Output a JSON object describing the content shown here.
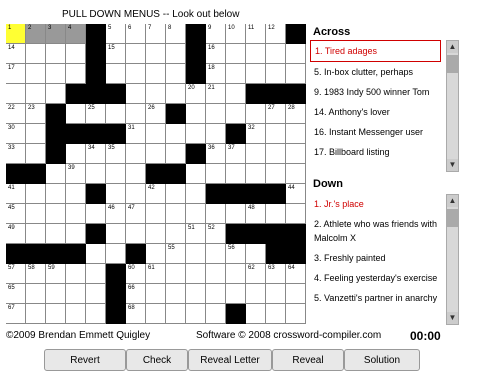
{
  "title": "PULL DOWN MENUS -- Look out below",
  "grid": {
    "rows": [
      "____#____#____#",
      "____#____#_____",
      "____#____#_____",
      "___###______###",
      "__#_____#______",
      "__####_____#___",
      "__#______#_____",
      "##_____##______",
      "____#_____####_",
      "_______________",
      "____#______####",
      "####__#______##",
      "_____#_________",
      "_____#_________",
      "_____#_____#___"
    ],
    "numbers": [
      [
        0,
        0,
        "1"
      ],
      [
        0,
        1,
        "2"
      ],
      [
        0,
        2,
        "3"
      ],
      [
        0,
        3,
        "4"
      ],
      [
        0,
        5,
        "5"
      ],
      [
        0,
        6,
        "6"
      ],
      [
        0,
        7,
        "7"
      ],
      [
        0,
        8,
        "8"
      ],
      [
        0,
        10,
        "9"
      ],
      [
        0,
        11,
        "10"
      ],
      [
        0,
        12,
        "11"
      ],
      [
        0,
        13,
        "12"
      ],
      [
        0,
        14,
        "13"
      ],
      [
        1,
        0,
        "14"
      ],
      [
        1,
        5,
        "15"
      ],
      [
        1,
        10,
        "16"
      ],
      [
        2,
        0,
        "17"
      ],
      [
        2,
        10,
        "18"
      ],
      [
        3,
        3,
        "19"
      ],
      [
        3,
        9,
        "20"
      ],
      [
        3,
        10,
        "21"
      ],
      [
        4,
        0,
        "22"
      ],
      [
        4,
        1,
        "23"
      ],
      [
        4,
        2,
        "24"
      ],
      [
        4,
        4,
        "25"
      ],
      [
        4,
        7,
        "26"
      ],
      [
        4,
        13,
        "27"
      ],
      [
        4,
        14,
        "28"
      ],
      [
        5,
        0,
        "30"
      ],
      [
        5,
        6,
        "31"
      ],
      [
        5,
        12,
        "32"
      ],
      [
        6,
        0,
        "33"
      ],
      [
        6,
        4,
        "34"
      ],
      [
        6,
        5,
        "35"
      ],
      [
        6,
        10,
        "36"
      ],
      [
        6,
        11,
        "37"
      ],
      [
        7,
        1,
        "38"
      ],
      [
        7,
        3,
        "39"
      ],
      [
        7,
        8,
        "40"
      ],
      [
        8,
        0,
        "41"
      ],
      [
        8,
        7,
        "42"
      ],
      [
        8,
        12,
        "43"
      ],
      [
        8,
        14,
        "44"
      ],
      [
        9,
        0,
        "45"
      ],
      [
        9,
        5,
        "46"
      ],
      [
        9,
        6,
        "47"
      ],
      [
        9,
        12,
        "48"
      ],
      [
        10,
        0,
        "49"
      ],
      [
        10,
        4,
        "50"
      ],
      [
        10,
        9,
        "51"
      ],
      [
        10,
        10,
        "52"
      ],
      [
        10,
        12,
        "53"
      ],
      [
        11,
        3,
        "54"
      ],
      [
        11,
        8,
        "55"
      ],
      [
        11,
        11,
        "56"
      ],
      [
        12,
        0,
        "57"
      ],
      [
        12,
        1,
        "58"
      ],
      [
        12,
        2,
        "59"
      ],
      [
        12,
        6,
        "60"
      ],
      [
        12,
        7,
        "61"
      ],
      [
        12,
        12,
        "62"
      ],
      [
        12,
        13,
        "63"
      ],
      [
        12,
        14,
        "64"
      ],
      [
        13,
        0,
        "65"
      ],
      [
        13,
        6,
        "66"
      ],
      [
        14,
        0,
        "67"
      ],
      [
        14,
        6,
        "68"
      ],
      [
        14,
        11,
        "69"
      ]
    ],
    "current_cell": [
      0,
      0
    ],
    "selected_cells": [
      [
        0,
        1
      ],
      [
        0,
        2
      ],
      [
        0,
        3
      ]
    ]
  },
  "across": {
    "heading": "Across",
    "clues": [
      {
        "text": "1. Tired adages",
        "state": "selected"
      },
      {
        "text": "5. In-box clutter, perhaps",
        "state": ""
      },
      {
        "text": "9. 1983 Indy 500 winner Tom",
        "state": ""
      },
      {
        "text": "14. Anthony's lover",
        "state": ""
      },
      {
        "text": "16. Instant Messenger user",
        "state": ""
      },
      {
        "text": "17. Billboard listing",
        "state": ""
      }
    ]
  },
  "down": {
    "heading": "Down",
    "clues": [
      {
        "text": "1. Jr.'s place",
        "state": "active"
      },
      {
        "text": "2. Athlete who was friends with Malcolm X",
        "state": ""
      },
      {
        "text": "3. Freshly painted",
        "state": ""
      },
      {
        "text": "4. Feeling yesterday's exercise",
        "state": ""
      },
      {
        "text": "5. Vanzetti's partner in anarchy",
        "state": ""
      }
    ]
  },
  "footer": {
    "copyright": "©2009 Brendan Emmett Quigley",
    "software": "Software © 2008 crossword-compiler.com",
    "timer": "00:00"
  },
  "buttons": {
    "revert": "Revert",
    "check": "Check",
    "reveal_letter": "Reveal Letter",
    "reveal": "Reveal",
    "solution": "Solution"
  },
  "colors": {
    "current": "#ffff33",
    "selected": "#999999",
    "active_clue": "#d00000"
  }
}
